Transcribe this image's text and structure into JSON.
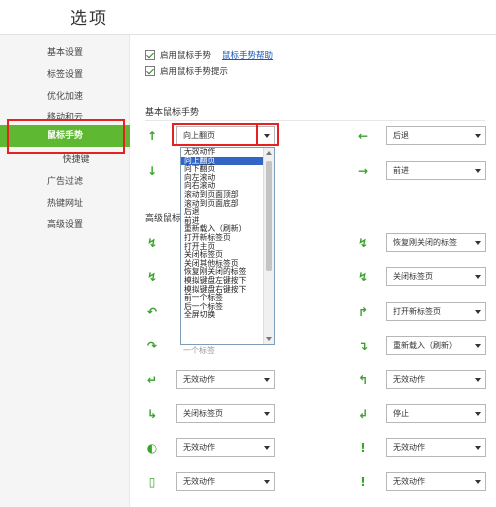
{
  "header": {
    "title": "选项"
  },
  "sidebar": {
    "items": [
      {
        "label": "基本设置"
      },
      {
        "label": "标签设置"
      },
      {
        "label": "优化加速"
      },
      {
        "label": "移动和云"
      },
      {
        "label": "鼠标手势"
      },
      {
        "label": "快捷键"
      },
      {
        "label": "广告过滤"
      },
      {
        "label": "热键网址"
      },
      {
        "label": "高级设置"
      }
    ],
    "active_index": 4
  },
  "options": {
    "enable_gesture": {
      "label": "启用鼠标手势",
      "checked": true
    },
    "gesture_help_link": "鼠标手势帮助",
    "enable_gesture_tip": {
      "label": "启用鼠标手势提示",
      "checked": true
    }
  },
  "basic": {
    "title": "基本鼠标手势",
    "left": [
      {
        "icon": "↑",
        "value": "向上翻页"
      },
      {
        "icon": "↓",
        "value": ""
      }
    ],
    "right": [
      {
        "icon": "←",
        "value": "后退"
      },
      {
        "icon": "→",
        "value": "前进"
      }
    ]
  },
  "advanced": {
    "title": "高级鼠标",
    "left": [
      {
        "icon": "↯",
        "value": ""
      },
      {
        "icon": "↯",
        "value": ""
      },
      {
        "icon": "↶",
        "value": ""
      },
      {
        "icon": "↷",
        "value": ""
      },
      {
        "icon": "↵",
        "value": "无效动作"
      },
      {
        "icon": "↳",
        "value": "关闭标签页"
      },
      {
        "icon": "◐",
        "value": "无效动作"
      },
      {
        "icon": "▯",
        "value": "无效动作"
      }
    ],
    "right": [
      {
        "icon": "↯",
        "value": "恢复刚关闭的标签"
      },
      {
        "icon": "↯",
        "value": "关闭标签页"
      },
      {
        "icon": "↱",
        "value": "打开新标签页"
      },
      {
        "icon": "↴",
        "value": "重新载入（刷新）"
      },
      {
        "icon": "↰",
        "value": "无效动作"
      },
      {
        "icon": "↲",
        "value": "停止"
      },
      {
        "icon": "!",
        "value": "无效动作"
      },
      {
        "icon": "!",
        "value": "无效动作"
      }
    ],
    "hidden_partial_label": "一个标签"
  },
  "dropdown": {
    "selected": "向上翻页",
    "options": [
      "无效动作",
      "向上翻页",
      "向下翻页",
      "向左滚动",
      "向右滚动",
      "滚动到页面顶部",
      "滚动到页面底部",
      "后退",
      "前进",
      "重新载入（刷新）",
      "打开新标签页",
      "打开主页",
      "关闭标签页",
      "关闭其他标签页",
      "恢复刚关闭的标签",
      "模拟键盘左键按下",
      "模拟键盘右键按下",
      "前一个标签",
      "后一个标签",
      "全屏切换"
    ]
  },
  "colors": {
    "accent": "#5fb832",
    "highlight": "#e5221f",
    "icon": "#3aa22c",
    "selection": "#3166c7"
  }
}
